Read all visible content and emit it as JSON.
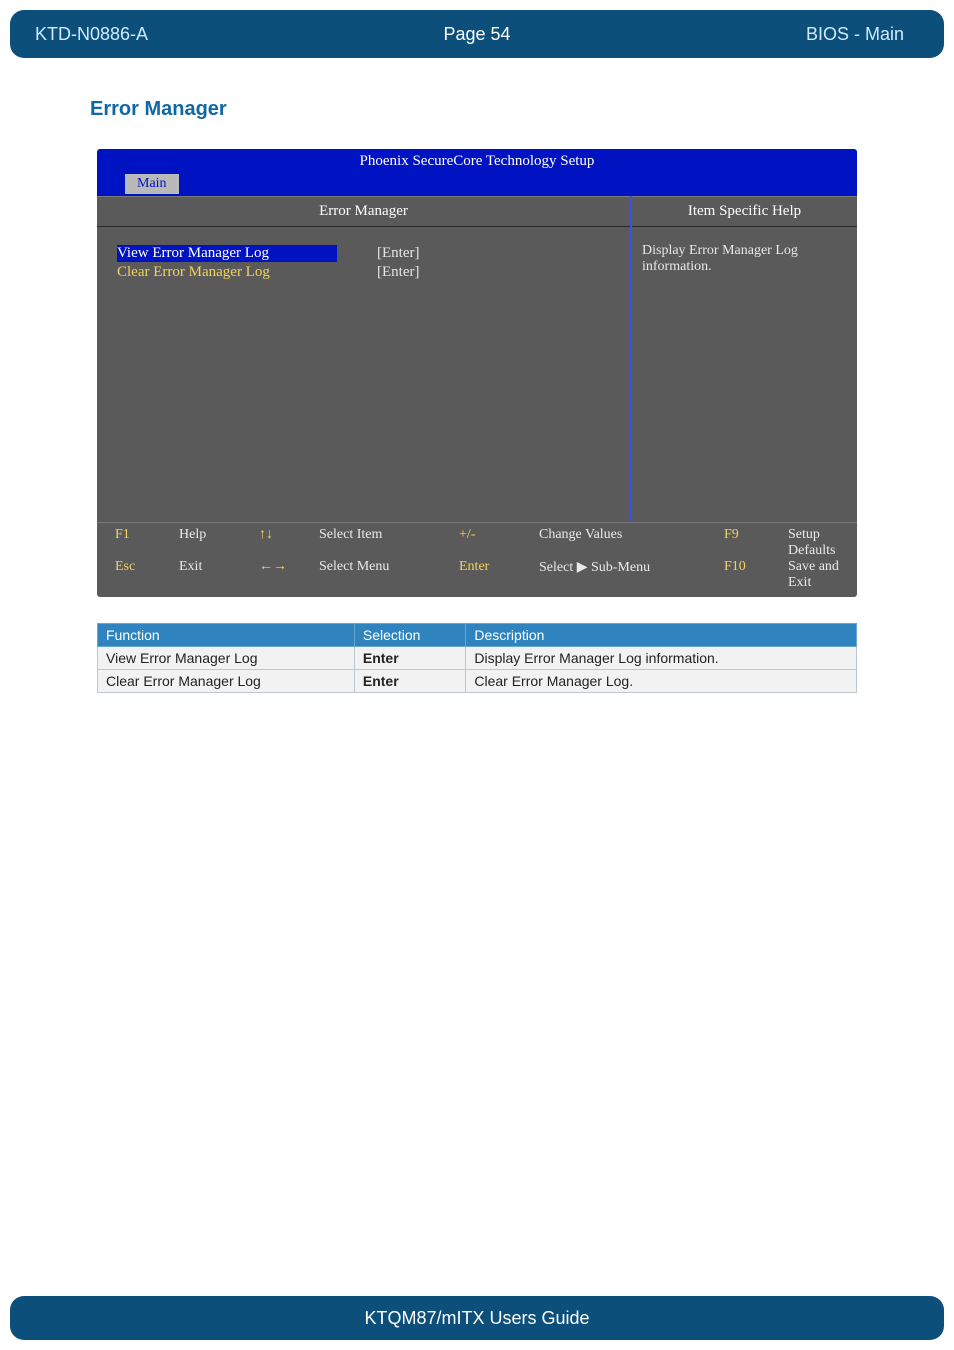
{
  "header": {
    "doc_id": "KTD-N0886-A",
    "page_label": "Page 54",
    "section": "BIOS  - Main"
  },
  "section_title": "Error Manager",
  "bios": {
    "title": "Phoenix SecureCore Technology Setup",
    "active_tab": "Main",
    "panel_title": "Error Manager",
    "help_title": "Item Specific Help",
    "help_body": "Display Error Manager Log information.",
    "rows": [
      {
        "label": "View Error Manager Log",
        "value": "[Enter]",
        "selected": true,
        "yellow": false
      },
      {
        "label": "Clear Error Manager Log",
        "value": "[Enter]",
        "selected": false,
        "yellow": true
      }
    ],
    "footer": {
      "r1": {
        "k1": "F1",
        "t1": "Help",
        "a1": "↑↓",
        "l1": "Select Item",
        "k2": "+/-",
        "l2": "Change Values",
        "k3": "F9",
        "l3": "Setup Defaults"
      },
      "r2": {
        "k1": "Esc",
        "t1": "Exit",
        "a1": "←→",
        "l1": "Select Menu",
        "k2": "Enter",
        "l2": "Select ▶ Sub-Menu",
        "k3": "F10",
        "l3": "Save and Exit"
      }
    }
  },
  "table": {
    "headers": {
      "c1": "Function",
      "c2": "Selection",
      "c3": "Description"
    },
    "rows": [
      {
        "fn": "View Error Manager Log",
        "sel": "Enter",
        "desc": "Display Error Manager Log information."
      },
      {
        "fn": "Clear Error Manager Log",
        "sel": "Enter",
        "desc": "Clear Error Manager Log."
      }
    ]
  },
  "footer": {
    "text": "KTQM87/mITX Users Guide"
  }
}
